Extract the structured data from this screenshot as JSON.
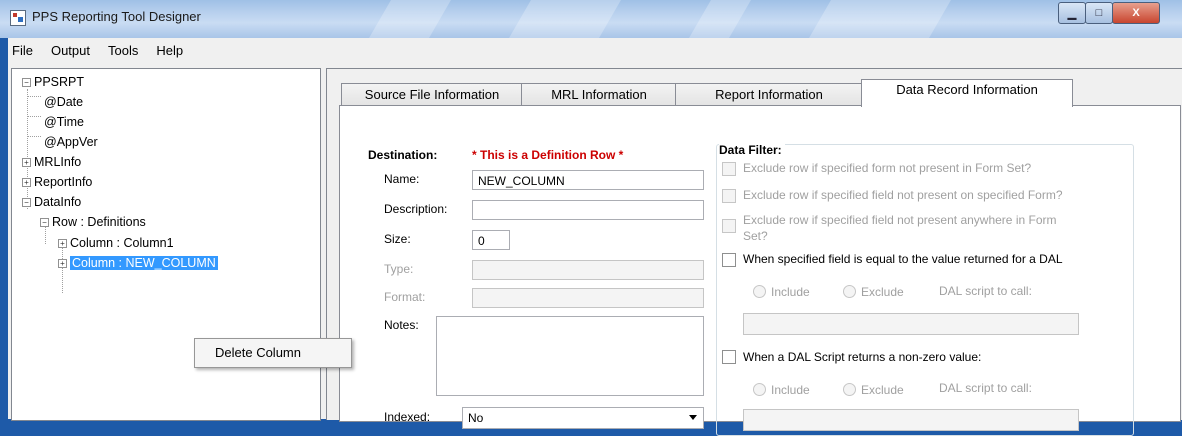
{
  "window": {
    "title": "PPS Reporting Tool Designer",
    "min": "▁",
    "max": "□",
    "close": "X"
  },
  "menu": [
    "File",
    "Output",
    "Tools",
    "Help"
  ],
  "tree": {
    "root": "PPSRPT",
    "date": "@Date",
    "time": "@Time",
    "appver": "@AppVer",
    "mrlinfo": "MRLInfo",
    "reportinfo": "ReportInfo",
    "datainfo": "DataInfo",
    "row": "Row : Definitions",
    "column1": "Column : Column1",
    "column2": "Column : NEW_COLUMN",
    "expand": "+",
    "collapse": "−"
  },
  "context_menu": {
    "delete": "Delete Column"
  },
  "tabs": [
    "Source File Information",
    "MRL Information",
    "Report Information",
    "Data Record Information"
  ],
  "destination": {
    "heading": "Destination:",
    "note": "* This is a Definition Row *",
    "name_label": "Name:",
    "name_value": "NEW_COLUMN",
    "description_label": "Description:",
    "description_value": "",
    "size_label": "Size:",
    "size_value": "0",
    "type_label": "Type:",
    "format_label": "Format:",
    "notes_label": "Notes:",
    "indexed_label": "Indexed:",
    "indexed_value": "No"
  },
  "filter": {
    "heading": "Data Filter:",
    "opt1": "Exclude row if specified form not present in Form Set?",
    "opt2": "Exclude row if specified field not present on specified Form?",
    "opt3a": "Exclude row if specified field not present anywhere in Form",
    "opt3b": "Set?",
    "opt4": "When specified field is equal to the value returned for a DAL",
    "include": "Include",
    "exclude": "Exclude",
    "dal_call": "DAL script to call:",
    "opt5": "When a DAL Script returns a non-zero value:"
  },
  "colors": {
    "selection": "#3399ff",
    "note_red": "#cc0000"
  }
}
